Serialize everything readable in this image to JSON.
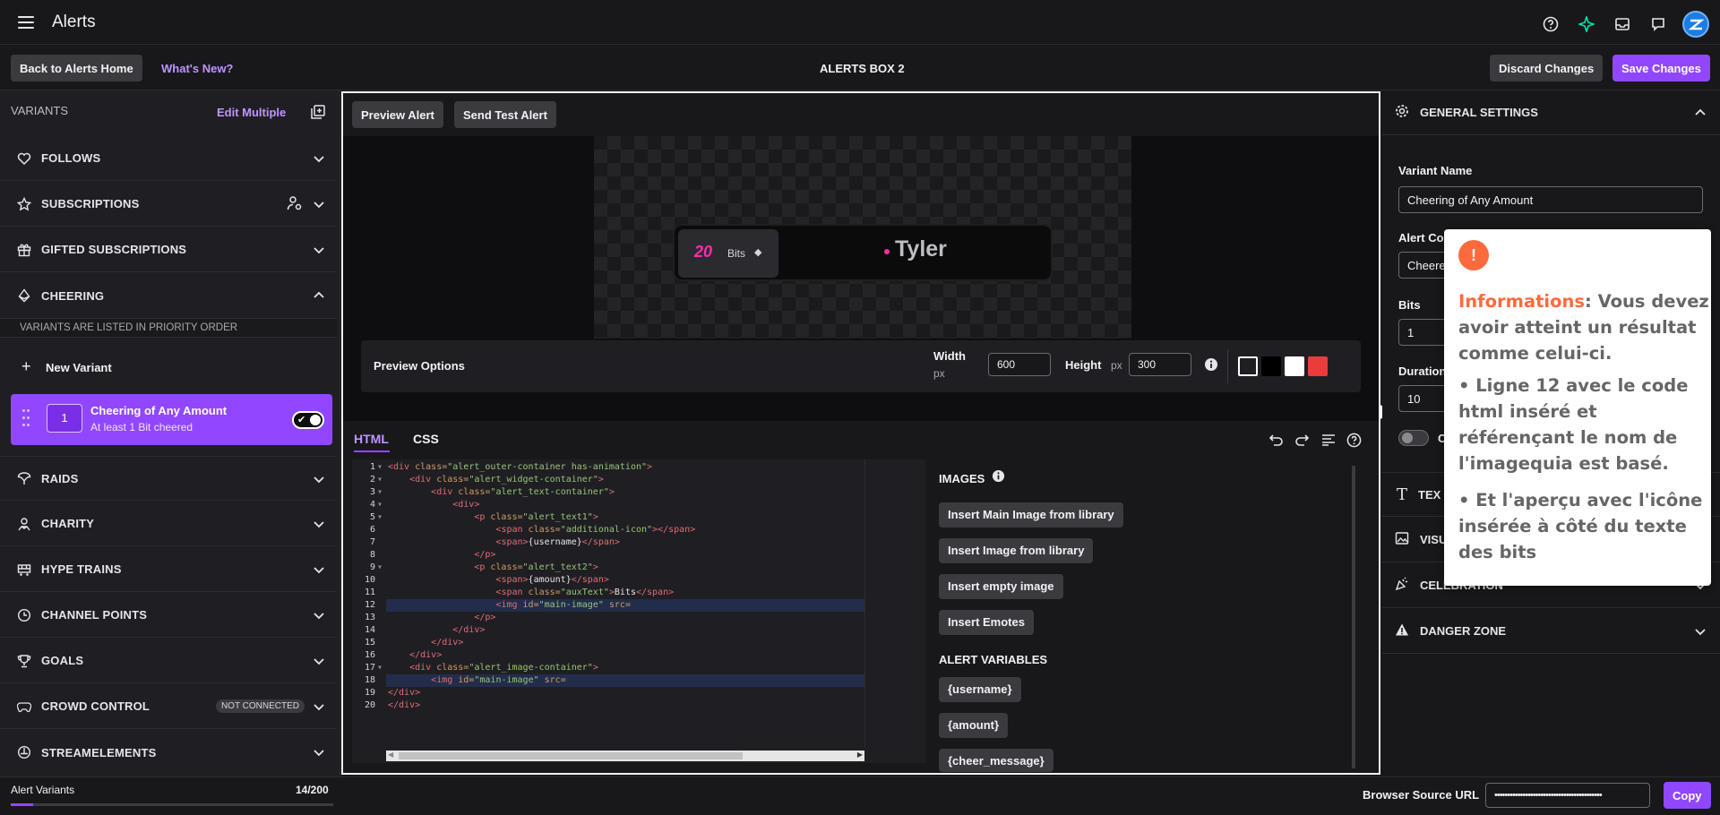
{
  "topbar": {
    "title": "Alerts"
  },
  "header": {
    "back_label": "Back to Alerts Home",
    "whats_new": "What's New?",
    "box_title": "ALERTS BOX 2",
    "discard_label": "Discard Changes",
    "save_label": "Save Changes"
  },
  "sidebar": {
    "variants_label": "VARIANTS",
    "edit_multiple": "Edit Multiple",
    "categories": [
      "FOLLOWS",
      "SUBSCRIPTIONS",
      "GIFTED SUBSCRIPTIONS",
      "CHEERING",
      "RAIDS",
      "CHARITY",
      "HYPE TRAINS",
      "CHANNEL POINTS",
      "GOALS",
      "CROWD CONTROL",
      "STREAMELEMENTS"
    ],
    "priority_note": "VARIANTS ARE LISTED IN PRIORITY ORDER",
    "new_variant": "New Variant",
    "variant": {
      "priority": "1",
      "name": "Cheering of Any Amount",
      "subtitle": "At least 1 Bit cheered"
    },
    "not_connected": "NOT CONNECTED"
  },
  "preview": {
    "preview_alert": "Preview Alert",
    "send_test_alert": "Send Test Alert",
    "alert_amount": "20",
    "alert_bits": "Bits",
    "alert_username": "Tyler",
    "options_label": "Preview Options",
    "width_label": "Width",
    "width_unit": "px",
    "width_value": "600",
    "height_label": "Height",
    "height_unit": "px",
    "height_value": "300",
    "swatch_colors": [
      "#1f1f23",
      "#000000",
      "#ffffff",
      "#eb3b3b"
    ]
  },
  "editor": {
    "tab_html": "HTML",
    "tab_css": "CSS",
    "line_numbers": [
      "1",
      "2",
      "3",
      "4",
      "5",
      "6",
      "7",
      "8",
      "9",
      "10",
      "11",
      "12",
      "13",
      "14",
      "15",
      "16",
      "17",
      "18",
      "19",
      "20"
    ],
    "lines": [
      {
        "indent": 0,
        "tag_open": "<div",
        "attr": " class=",
        "str": "\"alert_outer-container has-animation\"",
        "after": ">",
        "txt": "",
        "close": ""
      },
      {
        "indent": 1,
        "tag_open": "<div",
        "attr": " class=",
        "str": "\"alert_widget-container\"",
        "after": ">",
        "txt": "",
        "close": ""
      },
      {
        "indent": 2,
        "tag_open": "<div",
        "attr": " class=",
        "str": "\"alert_text-container\"",
        "after": ">",
        "txt": "",
        "close": ""
      },
      {
        "indent": 3,
        "tag_open": "<div>",
        "attr": "",
        "str": "",
        "after": "",
        "txt": "",
        "close": ""
      },
      {
        "indent": 4,
        "tag_open": "<p",
        "attr": " class=",
        "str": "\"alert_text1\"",
        "after": ">",
        "txt": "",
        "close": ""
      },
      {
        "indent": 5,
        "tag_open": "<span",
        "attr": " class=",
        "str": "\"additional-icon\"",
        "after": "></span>",
        "txt": "",
        "close": ""
      },
      {
        "indent": 5,
        "tag_open": "<span>",
        "attr": "",
        "str": "",
        "after": "",
        "txt": "{username}",
        "close": "</span>"
      },
      {
        "indent": 4,
        "tag_open": "</p>",
        "attr": "",
        "str": "",
        "after": "",
        "txt": "",
        "close": ""
      },
      {
        "indent": 4,
        "tag_open": "<p",
        "attr": " class=",
        "str": "\"alert_text2\"",
        "after": ">",
        "txt": "",
        "close": ""
      },
      {
        "indent": 5,
        "tag_open": "<span>",
        "attr": "",
        "str": "",
        "after": "",
        "txt": "{amount}",
        "close": "</span>"
      },
      {
        "indent": 5,
        "tag_open": "<span",
        "attr": " class=",
        "str": "\"auxText\"",
        "after": ">",
        "txt": "Bits",
        "close": "</span>"
      },
      {
        "indent": 5,
        "tag_open": "<img",
        "attr": " id=",
        "str": "\"main-image\"",
        "after": "",
        "txt": "",
        "close": " src="
      },
      {
        "indent": 4,
        "tag_open": "</p>",
        "attr": "",
        "str": "",
        "after": "",
        "txt": "",
        "close": ""
      },
      {
        "indent": 3,
        "tag_open": "</div>",
        "attr": "",
        "str": "",
        "after": "",
        "txt": "",
        "close": ""
      },
      {
        "indent": 2,
        "tag_open": "</div>",
        "attr": "",
        "str": "",
        "after": "",
        "txt": "",
        "close": ""
      },
      {
        "indent": 1,
        "tag_open": "</div>",
        "attr": "",
        "str": "",
        "after": "",
        "txt": "",
        "close": ""
      },
      {
        "indent": 1,
        "tag_open": "<div",
        "attr": " class=",
        "str": "\"alert_image-container\"",
        "after": ">",
        "txt": "",
        "close": ""
      },
      {
        "indent": 2,
        "tag_open": "<img",
        "attr": " id=",
        "str": "\"main-image\"",
        "after": "",
        "txt": "",
        "close": " src="
      },
      {
        "indent": 0,
        "tag_open": "</div>",
        "attr": "",
        "str": "",
        "after": "",
        "txt": "",
        "close": ""
      },
      {
        "indent": 0,
        "tag_open": "</div>",
        "attr": "",
        "str": "",
        "after": "",
        "txt": "",
        "close": ""
      }
    ],
    "images_label": "IMAGES",
    "image_buttons": [
      "Insert Main Image from library",
      "Insert Image from library",
      "Insert empty image",
      "Insert Emotes"
    ],
    "variables_label": "ALERT VARIABLES",
    "variables": [
      "{username}",
      "{amount}",
      "{cheer_message}"
    ]
  },
  "settings": {
    "general_label": "GENERAL SETTINGS",
    "variant_name_label": "Variant Name",
    "variant_name_value": "Cheering of Any Amount",
    "alert_condition_label": "Alert Co",
    "alert_condition_value": "Cheere",
    "bits_label": "Bits",
    "bits_value": "1",
    "duration_label": "Duration",
    "duration_value": "10",
    "toggle_letter": "C",
    "text_label": "TEX",
    "visuals_label": "VISU",
    "celebration_label": "CELEBRATION",
    "danger_label": "DANGER ZONE"
  },
  "popup": {
    "heading": "Informations",
    "colon": ":",
    "intro": " Vous devez avoir atteint un résultat comme celui-ci.",
    "point1": "• Ligne 12 avec le code html inséré et référençant le nom de l'imagequia est basé.",
    "point2": "• Et l'aperçu avec l'icône insérée à côté du texte des bits",
    "accent": "#ff6a3d"
  },
  "footer": {
    "alert_variants_label": "Alert Variants",
    "count": "14/200",
    "progress": 0.07,
    "browser_source_label": "Browser Source URL",
    "url_masked": "••••••••••••••••••••••••••••••••••••••••••",
    "copy_label": "Copy"
  }
}
